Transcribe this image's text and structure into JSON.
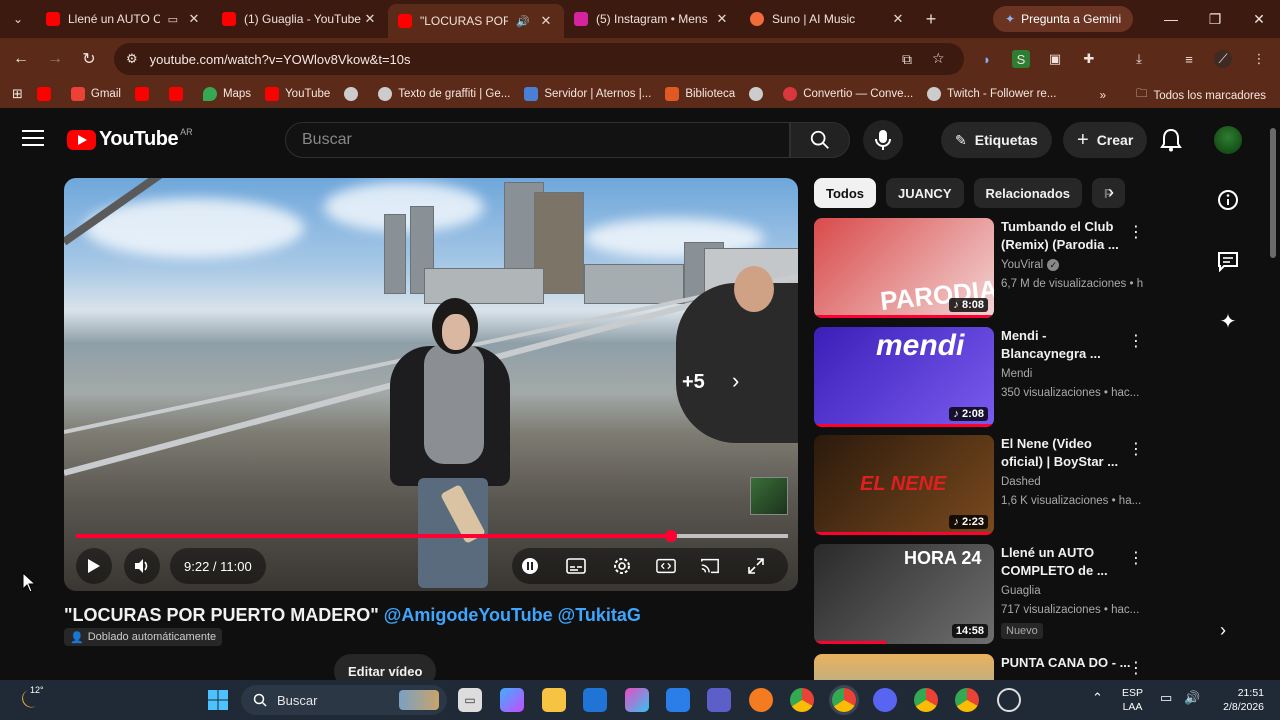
{
  "browser": {
    "tabs": [
      {
        "title": "Llené un AUTO CO",
        "favicon_color": "#ff0000",
        "extra": "▭",
        "active": false
      },
      {
        "title": "(1) Guaglia - YouTube",
        "favicon_color": "#ff0000",
        "active": false
      },
      {
        "title": "\"LOCURAS POR P",
        "favicon_color": "#ff0000",
        "extra": "🔊",
        "active": true
      },
      {
        "title": "(5) Instagram • Mens",
        "favicon_color": "#d6249f",
        "active": false
      },
      {
        "title": "Suno | AI Music",
        "favicon_color": "#f26b3a",
        "active": false
      }
    ],
    "gemini_label": "Pregunta a Gemini",
    "url": "youtube.com/watch?v=YOWlov8Vkow&t=10s",
    "bookmarks": [
      {
        "label": "",
        "color": "#ff0000"
      },
      {
        "label": "Gmail",
        "color": "#ea4335"
      },
      {
        "label": "",
        "color": "#ff0000"
      },
      {
        "label": "",
        "color": "#ff0000"
      },
      {
        "label": "Maps",
        "color": "#34a853"
      },
      {
        "label": "YouTube",
        "color": "#ff0000"
      },
      {
        "label": "",
        "color": "#cccccc"
      },
      {
        "label": "Texto de graffiti | Ge...",
        "color": "#cccccc"
      },
      {
        "label": "Servidor | Aternos |...",
        "color": "#4a7fd6"
      },
      {
        "label": "Biblioteca",
        "color": "#e25822"
      },
      {
        "label": "",
        "color": "#cccccc"
      },
      {
        "label": "Convertio — Conve...",
        "color": "#d9363e"
      },
      {
        "label": "Twitch - Follower re...",
        "color": "#cccccc"
      }
    ],
    "all_bookmarks_label": "Todos los marcadores"
  },
  "youtube": {
    "logo_text": "YouTube",
    "country": "AR",
    "search_placeholder": "Buscar",
    "tags_label": "Etiquetas",
    "create_label": "Crear",
    "player": {
      "more_videos": "+5",
      "time": "9:22 / 11:00",
      "progress": 0.836,
      "buffered": 1.0
    },
    "video_title": "\"LOCURAS POR PUERTO MADERO\"",
    "video_tags": "@AmigodeYouTube @TukitaG",
    "dubbed_label": "Doblado automáticamente",
    "edit_video_label": "Editar vídeo",
    "chips": [
      "Todos",
      "JUANCY",
      "Relacionados",
      "P"
    ],
    "recommendations": [
      {
        "title": "Tumbando el Club (Remix) (Parodia ...",
        "channel": "YouViral",
        "verified": true,
        "meta": "6,7 M de visualizaciones • h",
        "duration": "8:08",
        "thumb_text": "PARODIA",
        "thumb_colors": [
          "#d94a4a",
          "#f3d5d5"
        ],
        "watched": 1.0
      },
      {
        "title": "Mendi - Blancaynegra ...",
        "channel": "Mendi",
        "meta": "350 visualizaciones • hac...",
        "duration": "2:08",
        "thumb_text": "mendi",
        "thumb_colors": [
          "#3a1fb8",
          "#7b5cf0"
        ],
        "watched": 1.0
      },
      {
        "title": "El Nene (Video oficial) | BoyStar ...",
        "channel": "Dashed",
        "meta": "1,6 K visualizaciones • ha...",
        "duration": "2:23",
        "thumb_text": "EL NENE",
        "thumb_colors": [
          "#2b1a0c",
          "#7a4a1e"
        ],
        "watched": 1.0
      },
      {
        "title": "Llené un AUTO COMPLETO de ...",
        "channel": "Guaglia",
        "meta": "717 visualizaciones • hac...",
        "badge": "Nuevo",
        "duration": "14:58",
        "thumb_text": "HORA 24",
        "thumb_colors": [
          "#2a2a2a",
          "#6e6e6e"
        ],
        "watched": 0.4
      },
      {
        "title": "PUNTA CANA DO - ...",
        "channel": "",
        "meta": "",
        "duration": "",
        "thumb_text": "",
        "thumb_colors": [
          "#e9b35d",
          "#5fa3d6"
        ],
        "watched": 0
      }
    ]
  },
  "taskbar": {
    "temperature": "12°",
    "search_label": "Buscar",
    "lang": "ESP",
    "lang2": "LAA",
    "time": "21:51",
    "date": "2/8/2026"
  }
}
